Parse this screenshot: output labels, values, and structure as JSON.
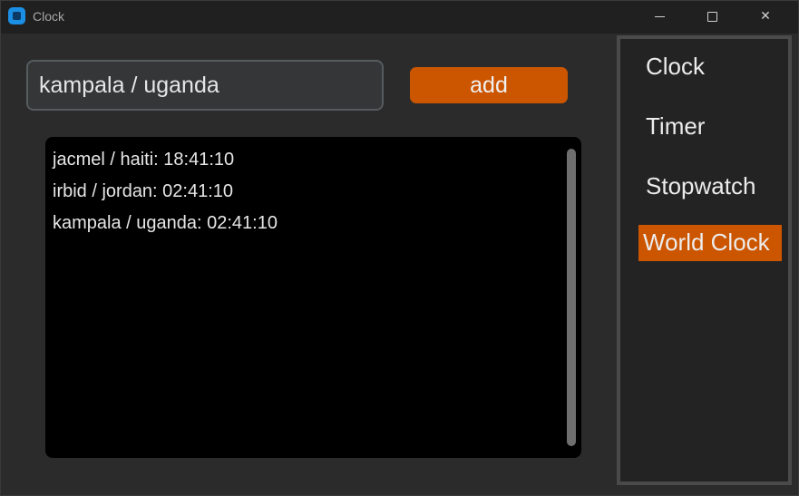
{
  "window": {
    "title": "Clock",
    "controls": {
      "minimize": "",
      "maximize": "",
      "close": "✕"
    }
  },
  "input": {
    "value": "kampala / uganda"
  },
  "add_button": {
    "label": "add"
  },
  "clocks": [
    "jacmel / haiti: 18:41:10",
    "irbid / jordan: 02:41:10",
    "kampala / uganda: 02:41:10"
  ],
  "sidebar": {
    "items": [
      {
        "label": "Clock",
        "active": false
      },
      {
        "label": "Timer",
        "active": false
      },
      {
        "label": "Stopwatch",
        "active": false
      },
      {
        "label": "World Clock",
        "active": true
      }
    ]
  },
  "colors": {
    "accent": "#cc5500",
    "background": "#2b2b2b",
    "list_background": "#000000"
  }
}
